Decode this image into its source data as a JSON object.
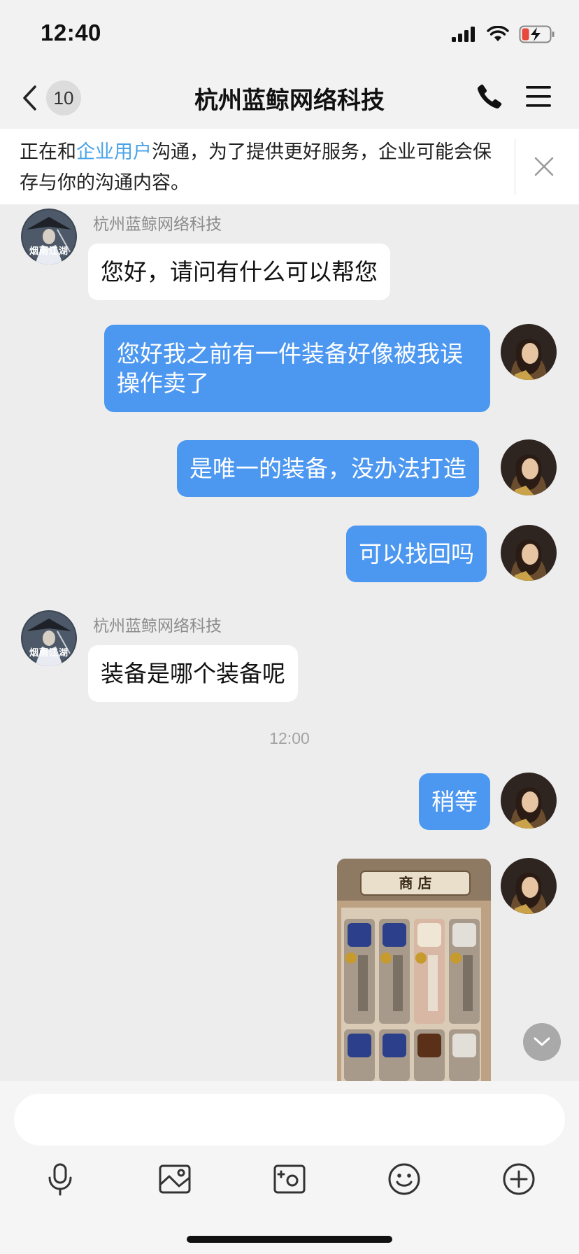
{
  "status_bar": {
    "time": "12:40"
  },
  "nav": {
    "back_badge": "10",
    "title": "杭州蓝鲸网络科技"
  },
  "notice": {
    "text_before": "正在和",
    "highlight": "企业用户",
    "text_after": "沟通，为了提供更好服务，企业可能会保存与你的沟通内容。"
  },
  "messages": [
    {
      "direction": "in",
      "sender": "杭州蓝鲸网络科技",
      "text": "您好，请问有什么可以帮您"
    },
    {
      "direction": "out",
      "text": "您好我之前有一件装备好像被我误操作卖了"
    },
    {
      "direction": "out",
      "text": "是唯一的装备，没办法打造"
    },
    {
      "direction": "out",
      "text": "可以找回吗"
    },
    {
      "direction": "in",
      "sender": "杭州蓝鲸网络科技",
      "text": "装备是哪个装备呢"
    },
    {
      "direction": "out",
      "text": "稍等"
    },
    {
      "direction": "out",
      "type": "image"
    }
  ],
  "time_divider": "12:00",
  "avatar_in_caption": "烟雨江湖",
  "image_message": {
    "shop_title": "商 店"
  },
  "input": {
    "placeholder": ""
  },
  "colors": {
    "outgoing_bubble": "#4c97f0",
    "notice_link": "#4aa3e8",
    "background": "#ededed"
  }
}
